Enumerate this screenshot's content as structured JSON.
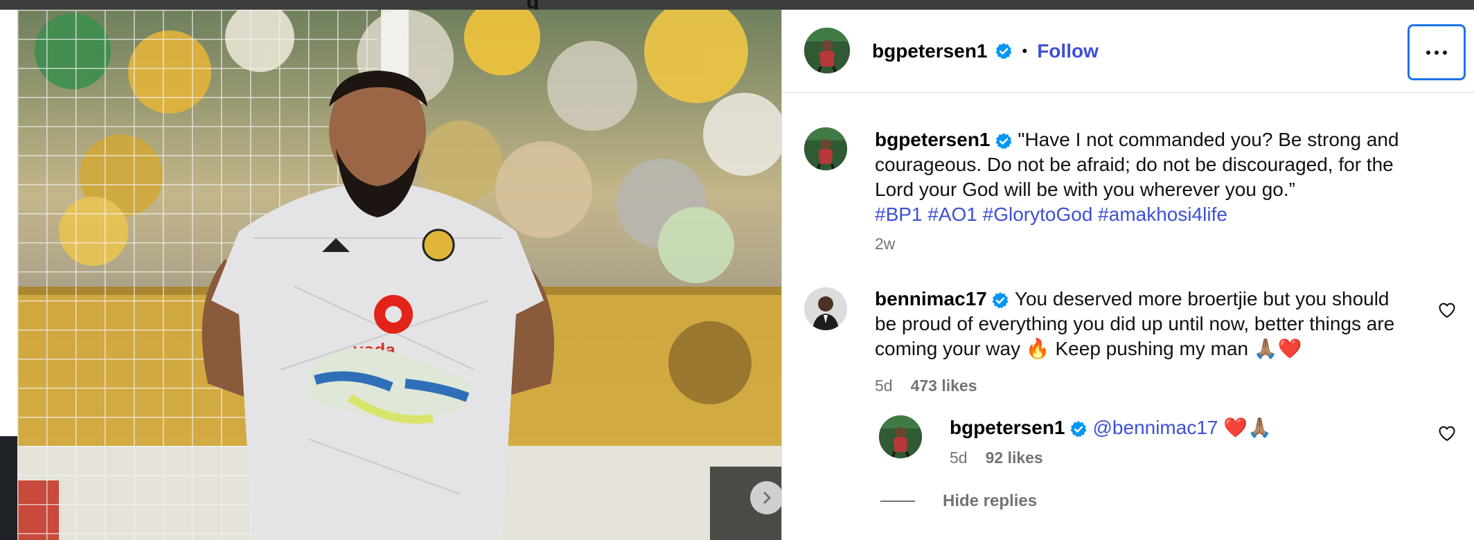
{
  "window": {
    "partial_title": "g"
  },
  "post": {
    "author": "bgpetersen1",
    "follow_label": "Follow",
    "separator": "•",
    "caption_text": "\"Have I not commanded you? Be strong and courageous. Do not be afraid; do not be discouraged, for the Lord your God will be with you wherever you go.”",
    "hashtags": "#BP1 #AO1 #GlorytoGod #amakhosi4life",
    "time_ago": "2w",
    "more_icon": "more-horizontal-icon",
    "next_icon": "chevron-right-icon"
  },
  "comments": [
    {
      "username": "bennimac17",
      "text": "You deserved more broertjie but you should be proud of everything you did up until now, better things are coming your way 🔥 Keep pushing my man 🙏🏽❤️",
      "time_ago": "5d",
      "likes": "473 likes"
    }
  ],
  "replies": [
    {
      "username": "bgpetersen1",
      "mention": "@bennimac17",
      "emoji": "❤️🙏🏽",
      "time_ago": "5d",
      "likes": "92 likes"
    }
  ],
  "hide_replies_label": "Hide replies",
  "colors": {
    "link_blue": "#3d4fd6",
    "verified_blue": "#0095f6",
    "muted": "#737373",
    "divider": "#dbdbdb",
    "focus_ring": "#1a73e8"
  }
}
